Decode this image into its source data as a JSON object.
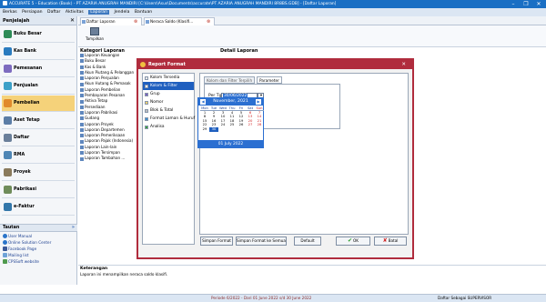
{
  "window": {
    "title": "ACCURATE 5 - Education (Book) - PT AZARIA ANUGRAH MANDIRI [C:\\Users\\Asus\\Documents\\accurate\\PT AZARIA ANUGRAH MANDIRI 8R8BS.GDB] - [Daftar Laporan]",
    "min": "–",
    "restore": "❐",
    "close": "✕"
  },
  "menu": [
    "Berkas",
    "Persiapan",
    "Daftar",
    "Aktivitas",
    "Laporan",
    "Jendela",
    "Bantuan"
  ],
  "sidebar": {
    "header": "Penjelajah",
    "close": "✕",
    "items": [
      {
        "label": "Buku Besar",
        "color": "#2e8b57"
      },
      {
        "label": "Kas Bank",
        "color": "#2a7bbf"
      },
      {
        "label": "Pemesanan",
        "color": "#7d6bbf"
      },
      {
        "label": "Penjualan",
        "color": "#3ca0c8"
      },
      {
        "label": "Pembelian",
        "color": "#e08a2c"
      },
      {
        "label": "Aset Tetap",
        "color": "#5b7da6"
      },
      {
        "label": "Daftar",
        "color": "#6a7f9a"
      },
      {
        "label": "RMA",
        "color": "#4f86b5"
      },
      {
        "label": "Proyek",
        "color": "#8a7a5c"
      },
      {
        "label": "Pabrikasi",
        "color": "#6f8c5a"
      },
      {
        "label": "e-Faktur",
        "color": "#3377aa"
      }
    ],
    "footer_title": "Tautan",
    "footer_close": "»",
    "links": [
      "User Manual",
      "Online Solution Center",
      "Facebook Page",
      "Mailing list",
      "CPSSoft website"
    ]
  },
  "tabs": [
    "Daftar Laporan",
    "Neraca Saldo (Klasifi..."
  ],
  "toolbar": {
    "tampilkan": "Tampilkan"
  },
  "kategori": {
    "title": "Kategori Laporan",
    "items": [
      "Laporan Keuangan",
      "Buku Besar",
      "Kas & Bank",
      "Akun Piutang & Pelanggan",
      "Laporan Penjualan",
      "Akun Hutang & Pemasok",
      "Laporan Pembelian",
      "Pembayaran Pesanan",
      "Aktiva Tetap",
      "Persediaan",
      "Laporan Pabrikasi",
      "Gudang",
      "Laporan Proyek",
      "Laporan Departemen",
      "Laporan Pemeriksaan",
      "Laporan Pajak (Indonesia)",
      "Laporan Lain-lain",
      "Laporan Tersimpan",
      "Laporan Tambahan ..."
    ]
  },
  "detail": {
    "title": "Detail Laporan"
  },
  "keterangan": {
    "title": "Keterangan",
    "text": "Laporan ini menampilkan neraca saldo klasifi."
  },
  "status": {
    "periode": "Periode 6/2022 - Dari 01 June 2022 s/d 30 June 2022",
    "user": "Daftar Sebagai SUPERVISOR"
  },
  "dialog": {
    "title": "Report Format",
    "close": "✕",
    "list": [
      {
        "label": "Kolom Tersedia",
        "color": "#e8e8e8"
      },
      {
        "label": "Kolom & Filter",
        "color": "#ffffff"
      },
      {
        "label": "Grup",
        "color": "#7a5fbf"
      },
      {
        "label": "Nomor",
        "color": "#f0d070"
      },
      {
        "label": "Blok & Total",
        "color": "#c0c0c0"
      },
      {
        "label": "Format Laman & Huruf",
        "color": "#3b8fd1"
      },
      {
        "label": "Analisa",
        "color": "#3aa040"
      }
    ],
    "tabs": [
      "Kolom dan Filter Terpilih",
      "Parameter"
    ],
    "field_label": "Per Tgl",
    "field_value": "30/06/2022",
    "calendar": {
      "month": "November, 2021",
      "dow": [
        "Mon",
        "Tue",
        "Wed",
        "Thu",
        "Fri",
        "Sat",
        "Sun"
      ],
      "weeks": [
        [
          "1",
          "2",
          "3",
          "4",
          "5",
          "6",
          "7"
        ],
        [
          "8",
          "9",
          "10",
          "11",
          "12",
          "13",
          "14"
        ],
        [
          "15",
          "16",
          "17",
          "18",
          "19",
          "20",
          "21"
        ],
        [
          "22",
          "23",
          "24",
          "25",
          "26",
          "27",
          "28"
        ],
        [
          "29",
          "30",
          "",
          "",
          "",
          "",
          ""
        ]
      ],
      "selected_day": "30",
      "today": "01 July 2022"
    },
    "buttons": {
      "simpan": "Simpan Format",
      "simpan_as": "Simpan Format ke Semua",
      "default": "Default",
      "ok": "OK",
      "batal": "Batal"
    }
  }
}
